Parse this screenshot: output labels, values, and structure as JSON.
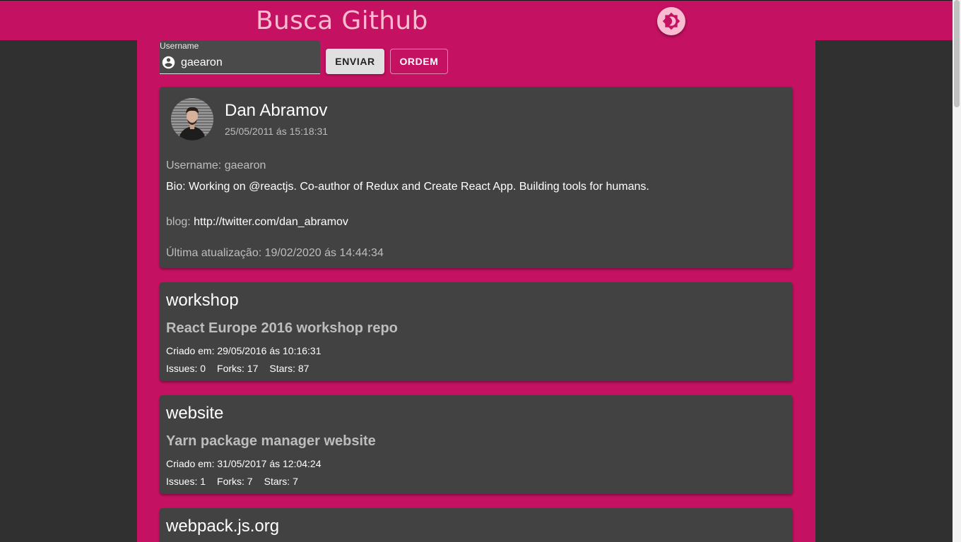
{
  "header": {
    "title": "Busca Github",
    "theme_toggle_icon": "brightness-icon",
    "accent_color": "#c51162"
  },
  "search": {
    "label": "Username",
    "value": "gaearon",
    "icon": "account-circle-icon",
    "send_label": "ENVIAR",
    "order_label": "ORDEM"
  },
  "profile": {
    "name": "Dan Abramov",
    "created": "25/05/2011 ás 15:18:31",
    "username_line": "Username: gaearon",
    "bio_line": "Bio: Working on @reactjs. Co-author of Redux and Create React App. Building tools for humans.",
    "blog_label": "blog:",
    "blog_url": "http://twitter.com/dan_abramov",
    "updated_line": "Última atualização: 19/02/2020 ás 14:44:34"
  },
  "repos": [
    {
      "name": "workshop",
      "description": "React Europe 2016 workshop repo",
      "created": "Criado em: 29/05/2016 ás 10:16:31",
      "issues": "Issues: 0",
      "forks": "Forks: 17",
      "stars": "Stars: 87"
    },
    {
      "name": "website",
      "description": "Yarn package manager website",
      "created": "Criado em: 31/05/2017 ás 12:04:24",
      "issues": "Issues: 1",
      "forks": "Forks: 7",
      "stars": "Stars: 7"
    },
    {
      "name": "webpack.js.org"
    }
  ]
}
